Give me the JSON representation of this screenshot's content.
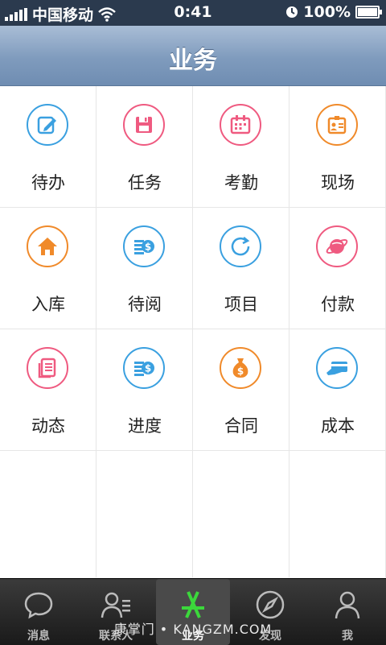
{
  "status_bar": {
    "carrier": "中国移动",
    "time": "0:41",
    "battery": "100%"
  },
  "header": {
    "title": "业务"
  },
  "grid": [
    {
      "label": "待办",
      "icon": "edit-icon",
      "color": "#3aa0e0"
    },
    {
      "label": "任务",
      "icon": "save-icon",
      "color": "#ef5a80"
    },
    {
      "label": "考勤",
      "icon": "calendar-icon",
      "color": "#ef5a80"
    },
    {
      "label": "现场",
      "icon": "badge-icon",
      "color": "#f08a2a"
    },
    {
      "label": "入库",
      "icon": "home-icon",
      "color": "#f08a2a"
    },
    {
      "label": "待阅",
      "icon": "coins-icon",
      "color": "#3aa0e0"
    },
    {
      "label": "项目",
      "icon": "refresh-icon",
      "color": "#3aa0e0"
    },
    {
      "label": "付款",
      "icon": "planet-icon",
      "color": "#ef5a80"
    },
    {
      "label": "动态",
      "icon": "document-icon",
      "color": "#ef5a80"
    },
    {
      "label": "进度",
      "icon": "coins-icon",
      "color": "#3aa0e0"
    },
    {
      "label": "合同",
      "icon": "money-bag-icon",
      "color": "#f08a2a"
    },
    {
      "label": "成本",
      "icon": "card-icon",
      "color": "#3aa0e0"
    }
  ],
  "tabbar": [
    {
      "label": "消息",
      "icon": "chat-bubble-icon"
    },
    {
      "label": "联系人",
      "icon": "contacts-icon"
    },
    {
      "label": "业务",
      "icon": "app-store-icon",
      "active": true
    },
    {
      "label": "发现",
      "icon": "compass-icon"
    },
    {
      "label": "我",
      "icon": "person-icon"
    }
  ],
  "watermark": "康掌门 • KANGZM.COM"
}
